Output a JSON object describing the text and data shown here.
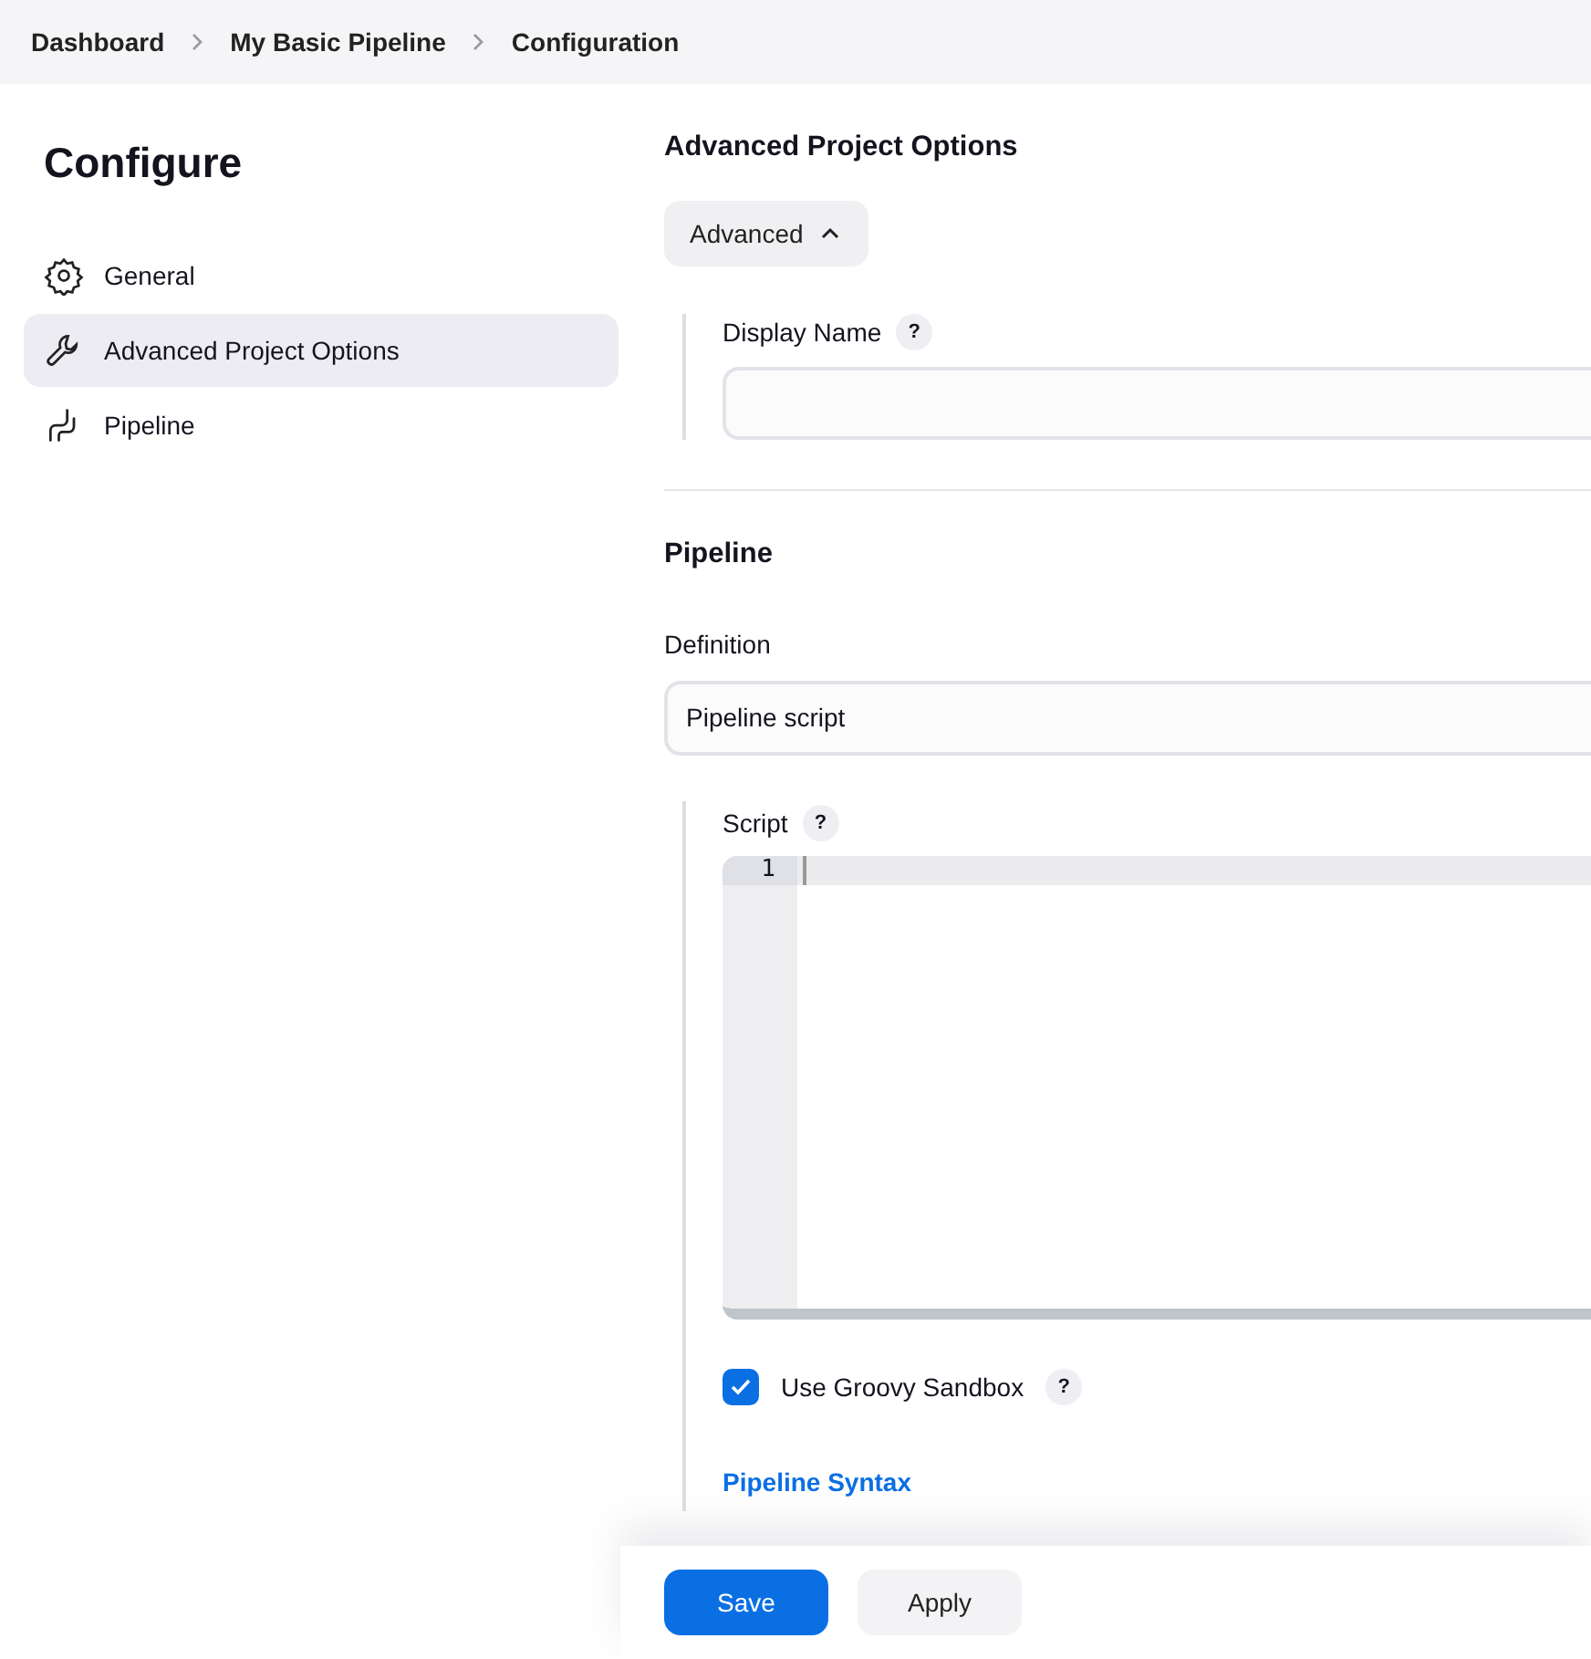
{
  "breadcrumbs": [
    "Dashboard",
    "My Basic Pipeline",
    "Configuration"
  ],
  "sidebar": {
    "title": "Configure",
    "items": [
      {
        "label": "General",
        "kind": "general",
        "selected": false
      },
      {
        "label": "Advanced Project Options",
        "kind": "advanced",
        "selected": true
      },
      {
        "label": "Pipeline",
        "kind": "pipeline",
        "selected": false
      }
    ]
  },
  "advanced_section": {
    "heading": "Advanced Project Options",
    "toggle": {
      "label": "Advanced",
      "expanded": true
    },
    "display_name": {
      "label": "Display Name",
      "help": "?"
    }
  },
  "pipeline_section": {
    "heading": "Pipeline",
    "definition": {
      "label": "Definition",
      "value": "Pipeline script"
    },
    "script": {
      "label": "Script",
      "help": "?",
      "line_numbers": [
        "1"
      ]
    },
    "sandbox": {
      "label": "Use Groovy Sandbox",
      "checked": true,
      "help": "?"
    },
    "syntax_link": "Pipeline Syntax"
  },
  "buttons": [
    {
      "label": "Save",
      "kind": "primary"
    },
    {
      "label": "Apply",
      "kind": "secondary"
    }
  ]
}
